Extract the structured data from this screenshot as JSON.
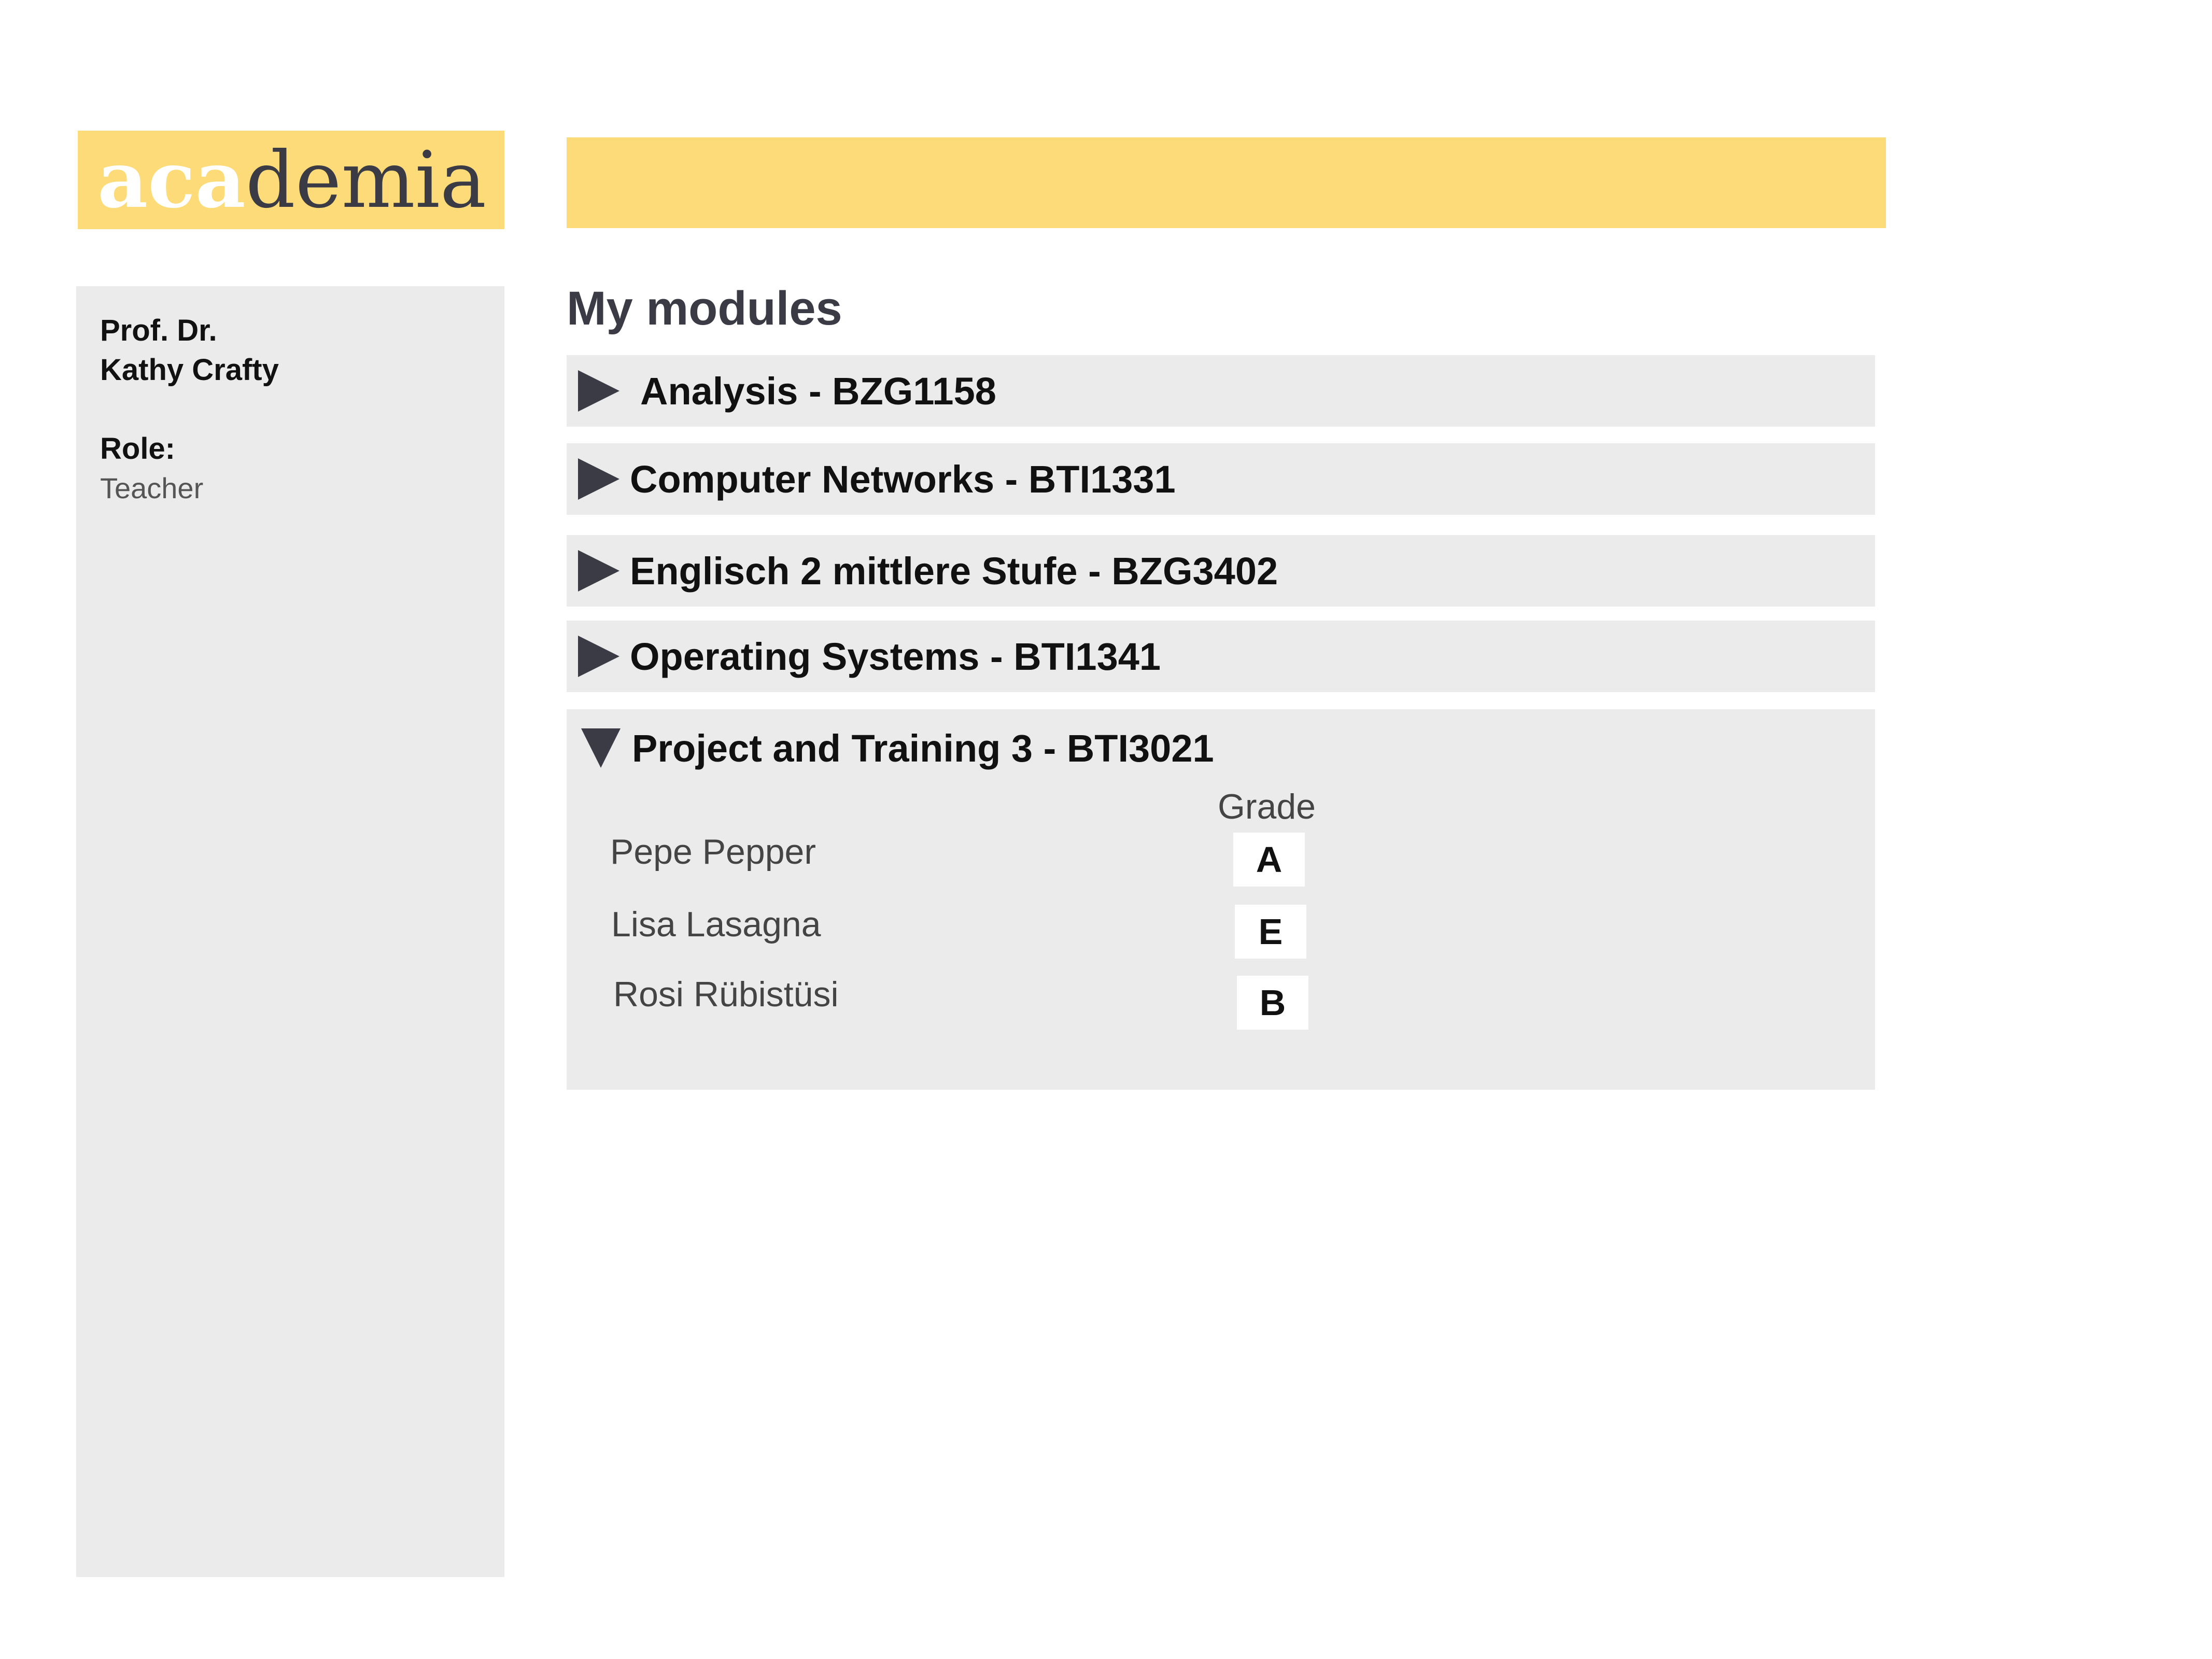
{
  "logo": {
    "part1": "aca",
    "part2": "demia"
  },
  "sidebar": {
    "name_line1": "Prof. Dr.",
    "name_line2": "Kathy Crafty",
    "role_label": "Role:",
    "role_value": "Teacher"
  },
  "main": {
    "heading": "My modules",
    "modules": [
      {
        "title": "Analysis - BZG1158",
        "expanded": false
      },
      {
        "title": "Computer Networks - BTI1331",
        "expanded": false
      },
      {
        "title": "Englisch 2 mittlere Stufe - BZG3402",
        "expanded": false
      },
      {
        "title": "Operating Systems - BTI1341",
        "expanded": false
      },
      {
        "title": "Project and Training 3 - BTI3021",
        "expanded": true,
        "grade_header": "Grade",
        "students": [
          {
            "name": "Pepe Pepper",
            "grade": "A"
          },
          {
            "name": "Lisa Lasagna",
            "grade": "E"
          },
          {
            "name": "Rosi Rübistüsi",
            "grade": "B"
          }
        ]
      }
    ]
  },
  "colors": {
    "accent": "#fcdb78",
    "panel": "#ebebeb",
    "dark": "#3a3b45"
  },
  "icons": {
    "collapsed": "triangle-right-icon",
    "expanded": "triangle-down-icon"
  }
}
